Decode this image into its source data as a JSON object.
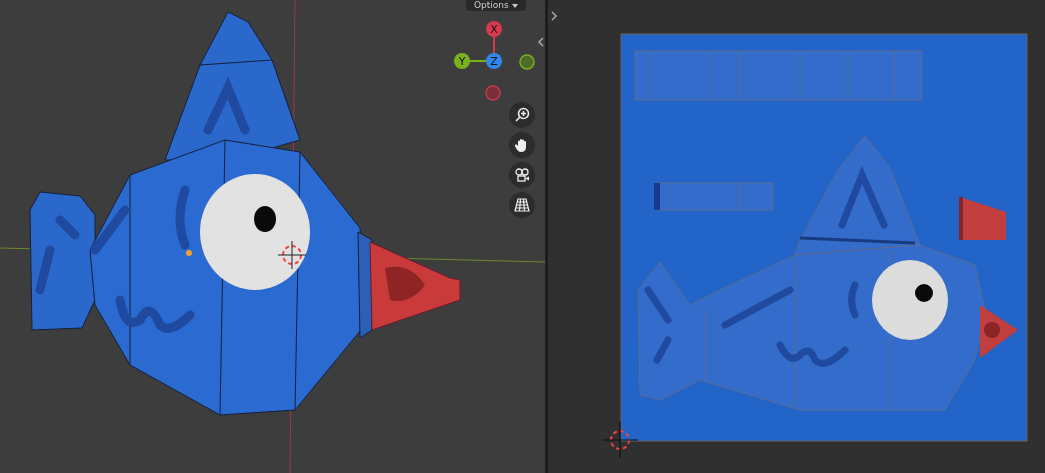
{
  "viewport": {
    "options_button": "Options",
    "gizmo": [
      {
        "label": "X",
        "color": "#d63a4e"
      },
      {
        "label": "Y",
        "color": "#7ab21e"
      },
      {
        "label": "Z",
        "color": "#2f88ef"
      }
    ]
  }
}
